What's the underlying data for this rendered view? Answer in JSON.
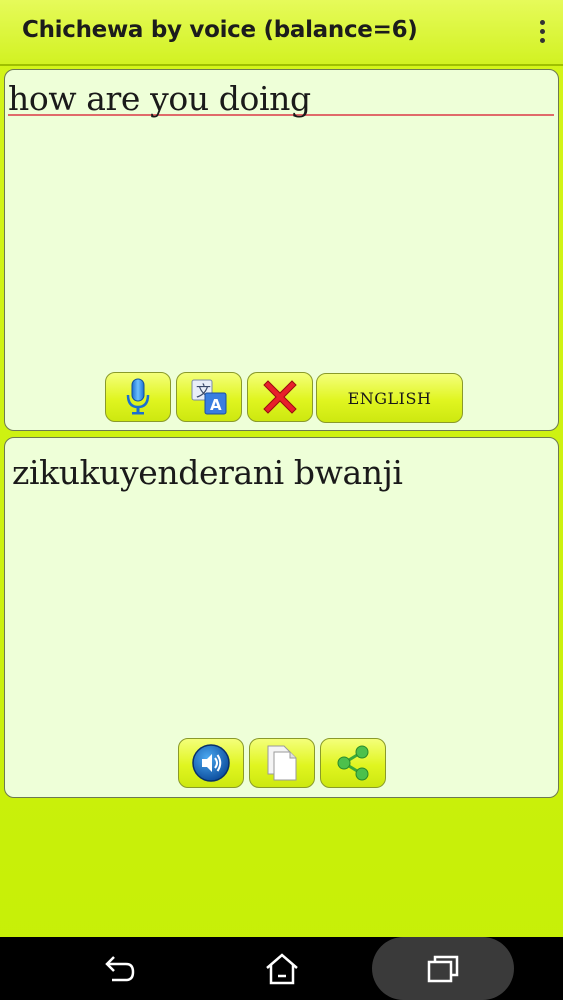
{
  "app_bar": {
    "title": "Chichewa by voice (balance=6)",
    "menu_icon": "overflow-menu-icon"
  },
  "input_panel": {
    "text": "how are you doing",
    "buttons": {
      "mic_icon": "microphone-icon",
      "translate_icon": "translate-icon",
      "clear_icon": "clear-icon",
      "language_label": "ENGLISH"
    }
  },
  "output_panel": {
    "text": "zikukuyenderani bwanji",
    "buttons": {
      "speak_icon": "speaker-icon",
      "copy_icon": "copy-icon",
      "share_icon": "share-icon"
    }
  },
  "nav_bar": {
    "back_icon": "back-icon",
    "home_icon": "home-icon",
    "recents_icon": "recents-icon"
  },
  "colors": {
    "background": "#c8f00a",
    "panel": "#eeffd8",
    "button": "#e0f520",
    "clear_red": "#e8202a",
    "mic_blue": "#2a8ee8"
  }
}
